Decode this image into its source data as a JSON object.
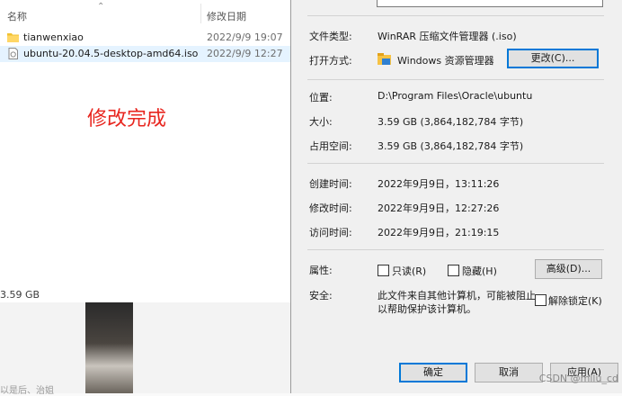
{
  "explorer": {
    "columns": {
      "name": "名称",
      "date": "修改日期"
    },
    "files": [
      {
        "name": "tianwenxiao",
        "date": "2022/9/9 19:07",
        "icon": "folder-icon"
      },
      {
        "name": "ubuntu-20.04.5-desktop-amd64.iso",
        "date": "2022/9/9 12:27",
        "icon": "iso-file-icon"
      }
    ],
    "annotation": "修改完成",
    "status_size": "3.59 GB"
  },
  "background": {
    "caption": "以是后、治姐"
  },
  "dialog": {
    "file_type_label": "文件类型:",
    "file_type_value": "WinRAR 压缩文件管理器 (.iso)",
    "open_with_label": "打开方式:",
    "open_with_value": "Windows 资源管理器",
    "change_button": "更改(C)...",
    "location_label": "位置:",
    "location_value": "D:\\Program Files\\Oracle\\ubuntu",
    "size_label": "大小:",
    "size_value": "3.59 GB (3,864,182,784 字节)",
    "size_on_disk_label": "占用空间:",
    "size_on_disk_value": "3.59 GB (3,864,182,784 字节)",
    "created_label": "创建时间:",
    "created_value": "2022年9月9日，13:11:26",
    "modified_label": "修改时间:",
    "modified_value": "2022年9月9日，12:27:26",
    "accessed_label": "访问时间:",
    "accessed_value": "2022年9月9日，21:19:15",
    "attributes_label": "属性:",
    "readonly_label": "只读(R)",
    "hidden_label": "隐藏(H)",
    "advanced_button": "高级(D)...",
    "security_label": "安全:",
    "security_text_1": "此文件来自其他计算机，可能被阻止",
    "security_text_2": "以帮助保护该计算机。",
    "unblock_label": "解除锁定(K)",
    "ok_button": "确定",
    "cancel_button": "取消",
    "apply_button": "应用(A)"
  },
  "watermark": "CSDN @mllu_cd",
  "colors": {
    "annotation": "#e8261f",
    "selection": "#e5f3ff",
    "focus": "#0078d7"
  }
}
